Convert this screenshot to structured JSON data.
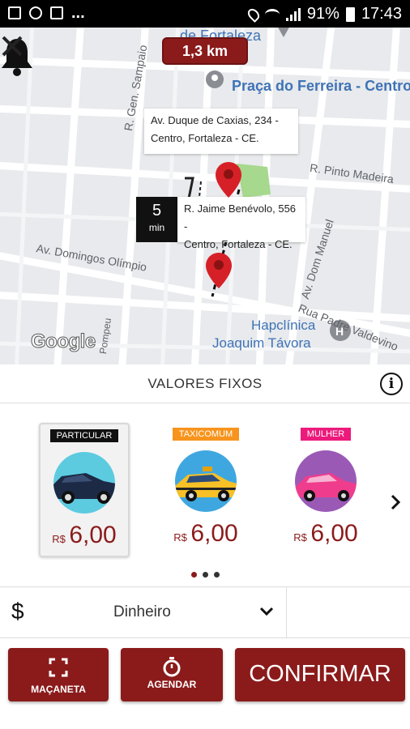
{
  "status_bar": {
    "battery": "91%",
    "time": "17:43",
    "dots": "..."
  },
  "map": {
    "top_label": "de Fortaleza",
    "distance": "1,3 km",
    "poi_name": "Praça do Ferreira - Centro",
    "poi_hospital_line1": "Hapclínica",
    "poi_hospital_line2": "Joaquim Távora",
    "street_labels": {
      "gen_sampaio": "R. Gen. Sampaio",
      "pinto_madeira": "R. Pinto Madeira",
      "domingos_olimpio": "Av. Domingos Olímpio",
      "dom_manuel": "Av. Dom Manuel",
      "padre_valdevino": "Rua Padre Valdevino",
      "pompeu": "Pompeu"
    },
    "origin_address_line1": "Av. Duque de Caxias, 234 -",
    "origin_address_line2": "Centro, Fortaleza - CE.",
    "eta_value": "5",
    "eta_unit": "min",
    "destination_address_line1": "R. Jaime Benévolo, 556 -",
    "destination_address_line2": "Centro, Fortaleza - CE.",
    "attribution": "Google",
    "marker_color": "#d62027",
    "park_color": "#a6d88e"
  },
  "section": {
    "title": "VALORES FIXOS"
  },
  "categories": [
    {
      "badge": "PARTICULAR",
      "badge_color": "#111111",
      "currency": "R$",
      "price": "6,00",
      "circle_color": "#5ccbe0",
      "car_color": "#1c2a45"
    },
    {
      "badge": "TAXICOMUM",
      "badge_color": "#f7941d",
      "currency": "R$",
      "price": "6,00",
      "circle_color": "#3fa7e0",
      "car_color": "#f6c026"
    },
    {
      "badge": "MULHER",
      "badge_color": "#ec1a7c",
      "currency": "R$",
      "price": "6,00",
      "circle_color": "#9b59b6",
      "car_color": "#f03c8c"
    }
  ],
  "payment": {
    "symbol": "$",
    "method": "Dinheiro"
  },
  "actions": {
    "macaneta": "MAÇANETA",
    "agendar": "AGENDAR",
    "confirmar": "CONFIRMAR"
  },
  "colors": {
    "brand": "#8b1b1b"
  }
}
